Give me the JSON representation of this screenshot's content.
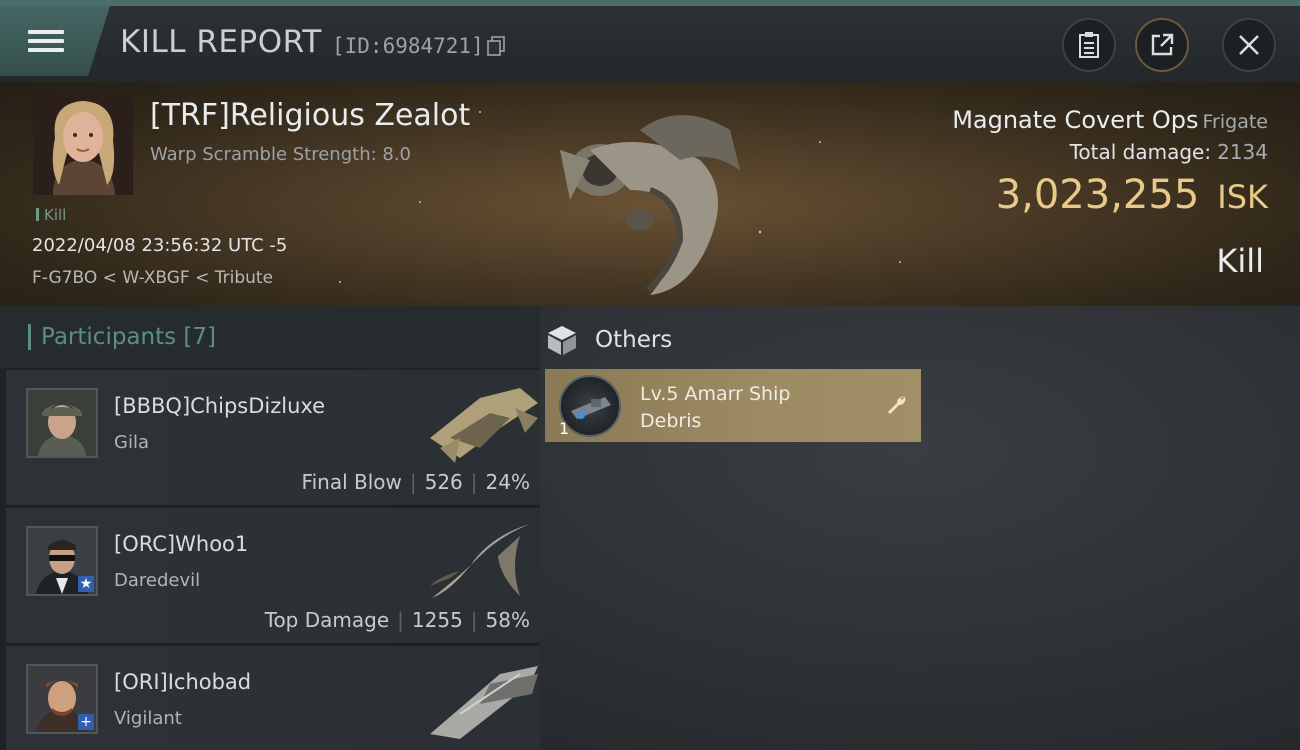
{
  "header": {
    "title": "KILL REPORT",
    "report_id": "[ID:6984721]",
    "icons": [
      "menu-icon",
      "copy-icon",
      "clipboard-icon",
      "share-icon",
      "close-icon"
    ]
  },
  "victim": {
    "name": "[TRF]Religious Zealot",
    "warp_scramble": "Warp Scramble Strength: 8.0",
    "kill_tag": "Kill",
    "datetime": "2022/04/08 23:56:32 UTC -5",
    "location": "F-G7BO < W-XBGF < Tribute",
    "ship_name": "Magnate Covert Ops",
    "ship_class": "Frigate",
    "total_damage_label": "Total damage:",
    "total_damage": "2134",
    "isk_value": "3,023,255",
    "isk_unit": "ISK",
    "result": "Kill"
  },
  "participants": {
    "header": "Participants [7]",
    "rows": [
      {
        "name": "[BBBQ]ChipsDizluxe",
        "ship": "Gila",
        "role": "Final Blow",
        "damage": "526",
        "percent": "24%",
        "badge": ""
      },
      {
        "name": "[ORC]Whoo1",
        "ship": "Daredevil",
        "role": "Top Damage",
        "damage": "1255",
        "percent": "58%",
        "badge": "★"
      },
      {
        "name": "[ORI]Ichobad",
        "ship": "Vigilant",
        "role": "",
        "damage": "",
        "percent": "",
        "badge": "+"
      }
    ]
  },
  "others": {
    "header": "Others",
    "items": [
      {
        "name": "Lv.5 Amarr Ship Debris",
        "qty": "1"
      }
    ]
  },
  "colors": {
    "accent_teal": "#5d8d88",
    "isk_gold": "#e8c98a",
    "loot_card": "#9c8b63"
  }
}
